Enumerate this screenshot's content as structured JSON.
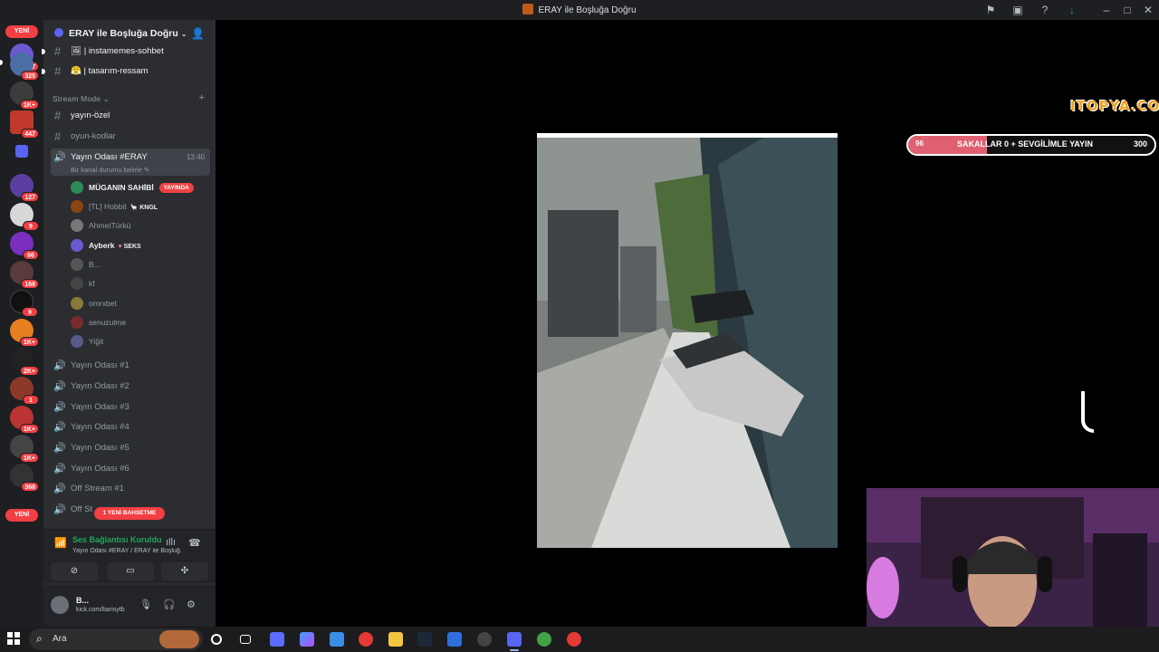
{
  "window": {
    "title": "ERAY ile Boşluğa Doğru"
  },
  "rail": {
    "new_top": "YENİ",
    "new_bottom": "YENİ",
    "badges": [
      "327",
      "325",
      "1K+",
      "447",
      "127",
      "9",
      "66",
      "168",
      "9",
      "1K+",
      "2K+",
      "1",
      "1K+",
      "1K+",
      "368"
    ]
  },
  "server": {
    "name": "ERAY ile Boşluğa Doğru"
  },
  "channels": {
    "top": [
      {
        "name": "instamemes-sohbet",
        "emoji": "🖼"
      },
      {
        "name": "tasarım-ressam",
        "emoji": "😤"
      }
    ],
    "category": "Stream Mode",
    "text": [
      {
        "name": "yayın-özel"
      },
      {
        "name": "oyun-kodlar"
      }
    ],
    "active_voice": {
      "name": "Yayın Odası #ERAY",
      "time": "13:40",
      "status": "Bir kanal durumu belirle"
    },
    "members": [
      {
        "name": "MÜGANIN SAHİBİ",
        "live": "YAYINDA"
      },
      {
        "name": "[TL] Hobbit",
        "tag": "KNGL"
      },
      {
        "name": "AhmetTürkü"
      },
      {
        "name": "Ayberk",
        "tag": "SEKS"
      },
      {
        "name": "B..."
      },
      {
        "name": "kf"
      },
      {
        "name": "omrxbet"
      },
      {
        "name": "senuzulme"
      },
      {
        "name": "Yiğit"
      }
    ],
    "voice": [
      "Yayın Odası #1",
      "Yayın Odası #2",
      "Yayın Odası #3",
      "Yayın Odası #4",
      "Yayın Odası #5",
      "Yayın Odası #6",
      "Off Stream #1",
      "Off St"
    ],
    "mention_pill": "1 YENİ BAHSETME"
  },
  "voice_panel": {
    "status": "Ses Bağlantısı Kuruldu",
    "channel": "Yayın Odası #ERAY / ERAY ile Boşluğ..."
  },
  "user_panel": {
    "name": "B...",
    "status": "kick.com/barisytb"
  },
  "stream": {
    "logo": "ITOPYA.COM",
    "goal": {
      "current": "96",
      "label": "SAKALLAR 0 + SEVGİLİMLE YAYIN",
      "target": "300",
      "progress": 0.32
    }
  },
  "taskbar": {
    "search_placeholder": "Ara"
  },
  "colors": {
    "accent": "#5865f2",
    "danger": "#f23f43",
    "online": "#23a55a"
  }
}
